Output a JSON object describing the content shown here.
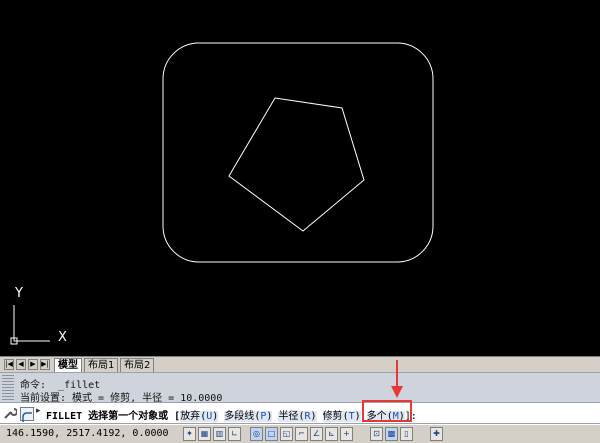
{
  "ucs": {
    "y_label": "Y",
    "x_label": "X"
  },
  "layout_tabs": [
    {
      "label": "模型",
      "active": true
    },
    {
      "label": "布局1",
      "active": false
    },
    {
      "label": "布局2",
      "active": false
    }
  ],
  "nav_buttons": [
    "|◀",
    "◀",
    "▶",
    "▶|"
  ],
  "command_history": [
    "命令:  _fillet",
    "当前设置: 模式 = 修剪, 半径 = 10.0000"
  ],
  "command_line": {
    "prefix": "FILLET 选择第一个对象或 [",
    "options": [
      {
        "label": "放弃",
        "key": "U"
      },
      {
        "label": "多段线",
        "key": "P"
      },
      {
        "label": "半径",
        "key": "R"
      },
      {
        "label": "修剪",
        "key": "T"
      },
      {
        "label": "多个",
        "key": "M"
      }
    ],
    "suffix": "]:"
  },
  "highlighted_option": "多个(M)",
  "status": {
    "coordinates": "146.1590, 2517.4192, 0.0000",
    "buttons": [
      "snap-icon",
      "grid-icon",
      "ortho-icon",
      "polar-icon",
      "osnap-icon",
      "otrack-icon",
      "ducs-icon",
      "dyn-icon",
      "lwt-icon",
      "qp-icon",
      "sc-icon",
      "model-icon",
      "layout-icon",
      "lock-icon",
      "fullscreen-icon"
    ]
  },
  "colors": {
    "highlight": "#e53935",
    "canvas": "#000000",
    "geometry": "#ffffff"
  }
}
